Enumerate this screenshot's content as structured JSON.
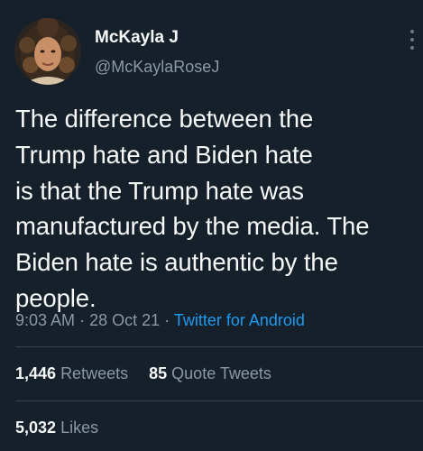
{
  "author": {
    "display_name": "McKayla J",
    "handle": "@McKaylaRoseJ"
  },
  "tweet": {
    "text": "The difference between the\nTrump hate and Biden hate\nis that the Trump hate was\nmanufactured by the media. The\nBiden hate is authentic by the\npeople.",
    "time": "9:03 AM",
    "date": "28 Oct 21",
    "separator": "·",
    "source": "Twitter for Android"
  },
  "stats": {
    "retweets_count": "1,446",
    "retweets_label": "Retweets",
    "quote_count": "85",
    "quote_label": "Quote Tweets",
    "likes_count": "5,032",
    "likes_label": "Likes"
  },
  "icons": {
    "more": "more-vertical-icon"
  },
  "colors": {
    "background": "#15202b",
    "primary_text": "#f7f9f9",
    "secondary_text": "#8b98a5",
    "link": "#1d9bf0",
    "divider": "#38444d"
  }
}
